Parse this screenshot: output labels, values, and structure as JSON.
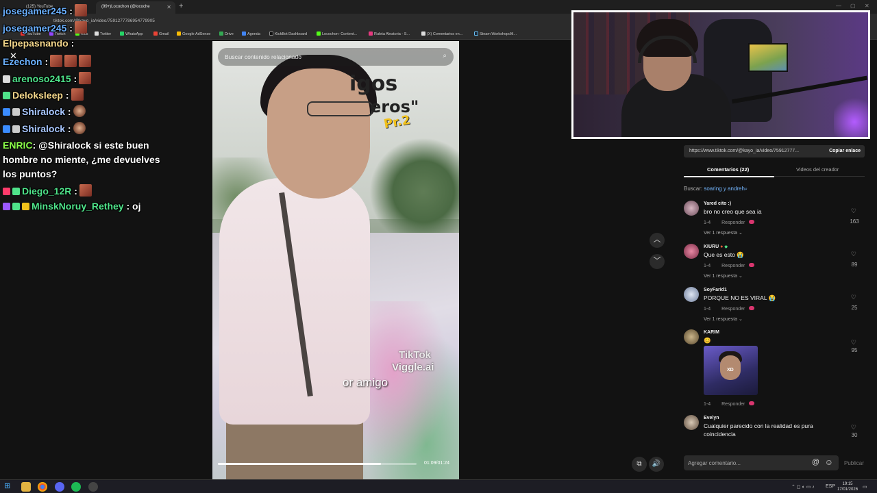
{
  "browser": {
    "tabs": [
      {
        "label": "(125) YouTube"
      },
      {
        "label": "(99+)Locochon (@locoche"
      }
    ],
    "url": "tiktok.com/@kayo_ia/video/7591277786954779905",
    "bookmarks": [
      "YouTube",
      "Twitch",
      "Kick",
      "Twitter",
      "WhatsApp",
      "Gmail",
      "Google AdSense",
      "Drive",
      "Agenda",
      "KickBot Dashboard",
      "Locochon- Content...",
      "Ruleta Aleatoria - S...",
      "(X) Comentarios en...",
      "Steam WorkshopcM..."
    ]
  },
  "video": {
    "search_placeholder": "Buscar contenido relacionado",
    "title_line1": "igos",
    "title_line2": "eros\"",
    "title_part": "Pr.2",
    "watermark_tiktok": "TikTok",
    "watermark_viggle": "Viggle.ai",
    "caption": "or amigo",
    "time": "01:09/01:24",
    "progress": 0.82
  },
  "panel": {
    "link_url": "https://www.tiktok.com/@kayo_ia/video/75912777...",
    "copy_label": "Copiar enlace",
    "tab_comments": "Comentarios (22)",
    "tab_creator": "Videos del creador",
    "search_prefix": "Buscar:",
    "search_term": "soaring y andreh",
    "comments": [
      {
        "user": "Yared cito :)",
        "text": "bro no creo que sea ia",
        "meta": "1-4",
        "reply": "Responder",
        "more": "Ver 1 respuesta",
        "likes": "163"
      },
      {
        "user": "KIURU",
        "text": "Que es esto 😭",
        "meta": "1-4",
        "reply": "Responder",
        "more": "Ver 1 respuesta",
        "likes": "89"
      },
      {
        "user": "SoyFarid1",
        "text": "PORQUE NO ES VIRAL 😭",
        "meta": "1-4",
        "reply": "Responder",
        "more": "Ver 1 respuesta",
        "likes": "25"
      },
      {
        "user": "KARIM",
        "text": "😊",
        "meta": "1-4",
        "reply": "Responder",
        "img_text": "XD",
        "likes": "95"
      },
      {
        "user": "Evelyn",
        "text": "Cualquier parecido con la realidad es pura",
        "text2": "coincidencia",
        "likes": "30"
      }
    ],
    "input_placeholder": "Agregar comentario...",
    "publish": "Publicar"
  },
  "chat": {
    "lines": [
      {
        "user": "josegamer245",
        "sep": " :",
        "color": "#6ab0ff"
      },
      {
        "user": "josegamer245",
        "sep": " :",
        "color": "#6ab0ff"
      },
      {
        "user": "Elpepasnando",
        "sep": " :",
        "color": "#f2d58a"
      },
      {
        "user": "Ezechon",
        "sep": " :",
        "color": "#6ab0ff"
      },
      {
        "user": "arenoso2415",
        "sep": " :",
        "color": "#4fe38a"
      },
      {
        "user": "Deloksleep",
        "sep": " :",
        "color": "#f2d58a"
      },
      {
        "user": "Shiralock",
        "sep": " :",
        "color": "#a9c7ff"
      },
      {
        "user": "Shiralock",
        "sep": " :",
        "color": "#a9c7ff"
      }
    ],
    "enric_user": "ENRIC",
    "enric_msg": ": @Shiralock si este buen hombre no miente, ¿me devuelves los puntos?",
    "diego_user": "Diego_12R",
    "diego_sep": " :",
    "minsk_user": "MinskNoruy_Rethey",
    "minsk_msg": " : oj",
    "close": "✕"
  },
  "taskbar": {
    "lang": "ESP",
    "time": "19:15",
    "date": "17/01/2026"
  },
  "colors": {
    "accent_heart": "#d9366f",
    "link_blue": "#74b6ff"
  }
}
